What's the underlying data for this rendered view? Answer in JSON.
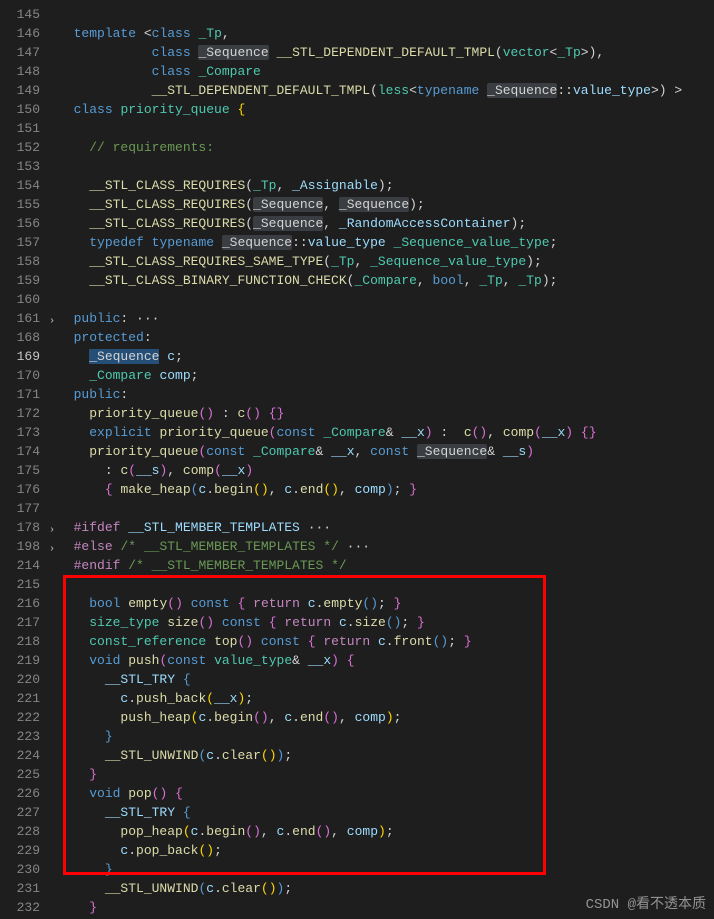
{
  "watermark": "CSDN @看不透本质",
  "lines": [
    {
      "n": "145",
      "c": ""
    },
    {
      "n": "146",
      "c": "  <span class='kw'>template</span> <span class='op'>&lt;</span><span class='kw'>class</span> <span class='type'>_Tp</span><span class='op'>,</span>"
    },
    {
      "n": "147",
      "c": "            <span class='kw'>class</span> <span class='hl'>_Sequence</span> <span class='fn'>__STL_DEPENDENT_DEFAULT_TMPL</span><span class='op'>(</span><span class='type'>vector</span><span class='op'>&lt;</span><span class='type'>_Tp</span><span class='op'>&gt;),</span>"
    },
    {
      "n": "148",
      "c": "            <span class='kw'>class</span> <span class='type'>_Compare</span>"
    },
    {
      "n": "149",
      "c": "            <span class='fn'>__STL_DEPENDENT_DEFAULT_TMPL</span><span class='op'>(</span><span class='type'>less</span><span class='op'>&lt;</span><span class='kw'>typename</span> <span class='hl'>_Sequence</span><span class='op'>::</span><span class='var'>value_type</span><span class='op'>&gt;) &gt;</span>"
    },
    {
      "n": "150",
      "c": "  <span class='kw'>class</span> <span class='type'>priority_queue</span> <span class='brace-y'>{</span>"
    },
    {
      "n": "151",
      "c": ""
    },
    {
      "n": "152",
      "c": "    <span class='cmt'>// requirements:</span>"
    },
    {
      "n": "153",
      "c": ""
    },
    {
      "n": "154",
      "c": "    <span class='fn'>__STL_CLASS_REQUIRES</span><span class='op'>(</span><span class='type'>_Tp</span><span class='op'>,</span> <span class='var'>_Assignable</span><span class='op'>);</span>"
    },
    {
      "n": "155",
      "c": "    <span class='fn'>__STL_CLASS_REQUIRES</span><span class='op'>(</span><span class='hl'>_Sequence</span><span class='op'>,</span> <span class='hl'>_Sequence</span><span class='op'>);</span>"
    },
    {
      "n": "156",
      "c": "    <span class='fn'>__STL_CLASS_REQUIRES</span><span class='op'>(</span><span class='hl'>_Sequence</span><span class='op'>,</span> <span class='var'>_RandomAccessContainer</span><span class='op'>);</span>"
    },
    {
      "n": "157",
      "c": "    <span class='kw'>typedef</span> <span class='kw'>typename</span> <span class='hl'>_Sequence</span><span class='op'>::</span><span class='var'>value_type</span> <span class='type'>_Sequence_value_type</span><span class='op'>;</span>"
    },
    {
      "n": "158",
      "c": "    <span class='fn'>__STL_CLASS_REQUIRES_SAME_TYPE</span><span class='op'>(</span><span class='type'>_Tp</span><span class='op'>,</span> <span class='type'>_Sequence_value_type</span><span class='op'>);</span>"
    },
    {
      "n": "159",
      "c": "    <span class='fn'>__STL_CLASS_BINARY_FUNCTION_CHECK</span><span class='op'>(</span><span class='type'>_Compare</span><span class='op'>,</span> <span class='kw'>bool</span><span class='op'>,</span> <span class='type'>_Tp</span><span class='op'>,</span> <span class='type'>_Tp</span><span class='op'>);</span>"
    },
    {
      "n": "160",
      "c": ""
    },
    {
      "n": "161",
      "c": "  <span class='kw'>public</span><span class='op'>: </span><span class='op'>···</span>",
      "fold": true
    },
    {
      "n": "168",
      "c": "  <span class='kw'>protected</span><span class='op'>:</span>"
    },
    {
      "n": "169",
      "c": "    <span class='sel'>_Sequence</span> <span class='var'>c</span><span class='op'>;</span>",
      "current": true
    },
    {
      "n": "170",
      "c": "    <span class='type'>_Compare</span> <span class='var'>comp</span><span class='op'>;</span>"
    },
    {
      "n": "171",
      "c": "  <span class='kw'>public</span><span class='op'>:</span>"
    },
    {
      "n": "172",
      "c": "    <span class='fn'>priority_queue</span><span class='brace-p'>()</span> <span class='op'>:</span> <span class='fn'>c</span><span class='brace-p'>()</span> <span class='brace-p'>{}</span>"
    },
    {
      "n": "173",
      "c": "    <span class='kw'>explicit</span> <span class='fn'>priority_queue</span><span class='brace-p'>(</span><span class='kw'>const</span> <span class='type'>_Compare</span><span class='op'>&amp;</span> <span class='var'>__x</span><span class='brace-p'>)</span> <span class='op'>:</span>  <span class='fn'>c</span><span class='brace-p'>()</span><span class='op'>,</span> <span class='fn'>comp</span><span class='brace-p'>(</span><span class='var'>__x</span><span class='brace-p'>)</span> <span class='brace-p'>{}</span>"
    },
    {
      "n": "174",
      "c": "    <span class='fn'>priority_queue</span><span class='brace-p'>(</span><span class='kw'>const</span> <span class='type'>_Compare</span><span class='op'>&amp;</span> <span class='var'>__x</span><span class='op'>,</span> <span class='kw'>const</span> <span class='hl'>_Sequence</span><span class='op'>&amp;</span> <span class='var'>__s</span><span class='brace-p'>)</span>"
    },
    {
      "n": "175",
      "c": "      <span class='op'>:</span> <span class='fn'>c</span><span class='brace-p'>(</span><span class='var'>__s</span><span class='brace-p'>)</span><span class='op'>,</span> <span class='fn'>comp</span><span class='brace-p'>(</span><span class='var'>__x</span><span class='brace-p'>)</span>"
    },
    {
      "n": "176",
      "c": "      <span class='brace-p'>{</span> <span class='fn'>make_heap</span><span class='brace-b'>(</span><span class='var'>c</span><span class='op'>.</span><span class='fn'>begin</span><span class='brace-y'>()</span><span class='op'>,</span> <span class='var'>c</span><span class='op'>.</span><span class='fn'>end</span><span class='brace-y'>()</span><span class='op'>,</span> <span class='var'>comp</span><span class='brace-b'>)</span><span class='op'>;</span> <span class='brace-p'>}</span>"
    },
    {
      "n": "177",
      "c": ""
    },
    {
      "n": "178",
      "c": "  <span class='kw2'>#ifdef</span> <span class='var'>__STL_MEMBER_TEMPLATES</span> <span class='op'>···</span>",
      "fold": true
    },
    {
      "n": "198",
      "c": "  <span class='kw2'>#else</span> <span class='cmt'>/* __STL_MEMBER_TEMPLATES */</span><span class='op'> ···</span>",
      "fold": true
    },
    {
      "n": "214",
      "c": "  <span class='kw2'>#endif</span> <span class='cmt'>/* __STL_MEMBER_TEMPLATES */</span>"
    },
    {
      "n": "215",
      "c": ""
    },
    {
      "n": "216",
      "c": "    <span class='kw'>bool</span> <span class='fn'>empty</span><span class='brace-p'>()</span> <span class='kw'>const</span> <span class='brace-p'>{</span> <span class='kw2'>return</span> <span class='var'>c</span><span class='op'>.</span><span class='fn'>empty</span><span class='brace-b'>()</span><span class='op'>;</span> <span class='brace-p'>}</span>"
    },
    {
      "n": "217",
      "c": "    <span class='type'>size_type</span> <span class='fn'>size</span><span class='brace-p'>()</span> <span class='kw'>const</span> <span class='brace-p'>{</span> <span class='kw2'>return</span> <span class='var'>c</span><span class='op'>.</span><span class='fn'>size</span><span class='brace-b'>()</span><span class='op'>;</span> <span class='brace-p'>}</span>"
    },
    {
      "n": "218",
      "c": "    <span class='type'>const_reference</span> <span class='fn'>top</span><span class='brace-p'>()</span> <span class='kw'>const</span> <span class='brace-p'>{</span> <span class='kw2'>return</span> <span class='var'>c</span><span class='op'>.</span><span class='fn'>front</span><span class='brace-b'>()</span><span class='op'>;</span> <span class='brace-p'>}</span>"
    },
    {
      "n": "219",
      "c": "    <span class='kw'>void</span> <span class='fn'>push</span><span class='brace-p'>(</span><span class='kw'>const</span> <span class='type'>value_type</span><span class='op'>&amp;</span> <span class='var'>__x</span><span class='brace-p'>)</span> <span class='brace-p'>{</span>"
    },
    {
      "n": "220",
      "c": "      <span class='var'>__STL_TRY</span> <span class='brace-b'>{</span>"
    },
    {
      "n": "221",
      "c": "        <span class='var'>c</span><span class='op'>.</span><span class='fn'>push_back</span><span class='brace-y'>(</span><span class='var'>__x</span><span class='brace-y'>)</span><span class='op'>;</span>"
    },
    {
      "n": "222",
      "c": "        <span class='fn'>push_heap</span><span class='brace-y'>(</span><span class='var'>c</span><span class='op'>.</span><span class='fn'>begin</span><span class='brace-p'>()</span><span class='op'>,</span> <span class='var'>c</span><span class='op'>.</span><span class='fn'>end</span><span class='brace-p'>()</span><span class='op'>,</span> <span class='var'>comp</span><span class='brace-y'>)</span><span class='op'>;</span>"
    },
    {
      "n": "223",
      "c": "      <span class='brace-b'>}</span>"
    },
    {
      "n": "224",
      "c": "      <span class='fn'>__STL_UNWIND</span><span class='brace-b'>(</span><span class='var'>c</span><span class='op'>.</span><span class='fn'>clear</span><span class='brace-y'>()</span><span class='brace-b'>)</span><span class='op'>;</span>"
    },
    {
      "n": "225",
      "c": "    <span class='brace-p'>}</span>"
    },
    {
      "n": "226",
      "c": "    <span class='kw'>void</span> <span class='fn'>pop</span><span class='brace-p'>()</span> <span class='brace-p'>{</span>"
    },
    {
      "n": "227",
      "c": "      <span class='var'>__STL_TRY</span> <span class='brace-b'>{</span>"
    },
    {
      "n": "228",
      "c": "        <span class='fn'>pop_heap</span><span class='brace-y'>(</span><span class='var'>c</span><span class='op'>.</span><span class='fn'>begin</span><span class='brace-p'>()</span><span class='op'>,</span> <span class='var'>c</span><span class='op'>.</span><span class='fn'>end</span><span class='brace-p'>()</span><span class='op'>,</span> <span class='var'>comp</span><span class='brace-y'>)</span><span class='op'>;</span>"
    },
    {
      "n": "229",
      "c": "        <span class='var'>c</span><span class='op'>.</span><span class='fn'>pop_back</span><span class='brace-y'>()</span><span class='op'>;</span>"
    },
    {
      "n": "230",
      "c": "      <span class='brace-b'>}</span>"
    },
    {
      "n": "231",
      "c": "      <span class='fn'>__STL_UNWIND</span><span class='brace-b'>(</span><span class='var'>c</span><span class='op'>.</span><span class='fn'>clear</span><span class='brace-y'>()</span><span class='brace-b'>)</span><span class='op'>;</span>"
    },
    {
      "n": "232",
      "c": "    <span class='brace-p'>}</span>"
    }
  ]
}
